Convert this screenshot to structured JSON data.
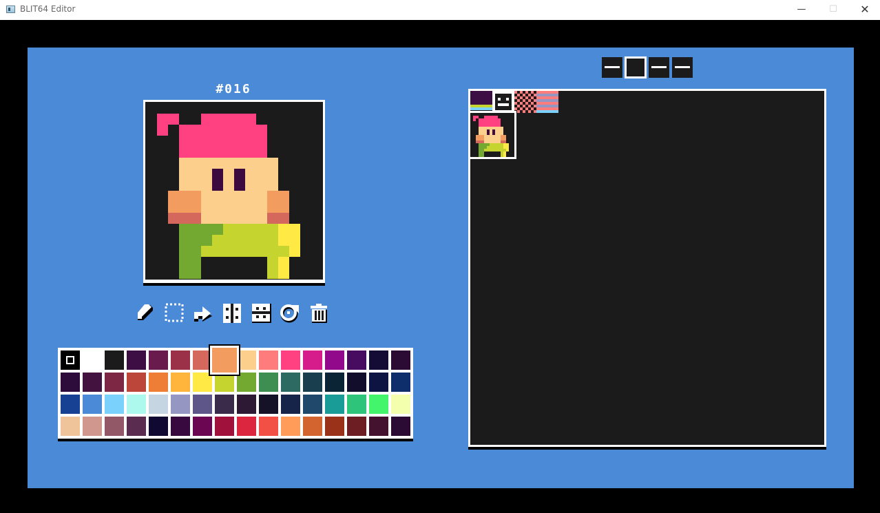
{
  "window": {
    "title": "BLIT64 Editor",
    "min_glyph": "—",
    "max_glyph": "☐",
    "close_glyph": "✕"
  },
  "editor": {
    "sprite_number": "#016"
  },
  "tools": [
    {
      "name": "pencil-tool-icon"
    },
    {
      "name": "select-tool-icon"
    },
    {
      "name": "move-tool-icon"
    },
    {
      "name": "flip-horizontal-tool-icon"
    },
    {
      "name": "flip-vertical-tool-icon"
    },
    {
      "name": "rotate-tool-icon"
    },
    {
      "name": "delete-tool-icon"
    }
  ],
  "palette": {
    "selected_index": 7,
    "marked_index": 0,
    "colors": [
      "#000000",
      "#ffffff",
      "#1b1b1b",
      "#3d0e44",
      "#6a1b4d",
      "#9b3148",
      "#d4685c",
      "#f39c5f",
      "#fccf8d",
      "#fe7c7c",
      "#ff4182",
      "#d61c8a",
      "#920a8b",
      "#470b60",
      "#140c34",
      "#2b0a33",
      "#2d0b3b",
      "#43123e",
      "#7e2744",
      "#bc463a",
      "#ee7e36",
      "#ffb43c",
      "#ffea45",
      "#c6d42f",
      "#74a931",
      "#3e8e51",
      "#2d6b62",
      "#193f4e",
      "#0b2435",
      "#120d2a",
      "#0e1442",
      "#0e2d6b",
      "#174192",
      "#4a8ad6",
      "#7ad1fb",
      "#aef9ee",
      "#c5d5e2",
      "#9696c2",
      "#5e5689",
      "#3a2b4b",
      "#2e1935",
      "#151227",
      "#16244a",
      "#20486b",
      "#199b97",
      "#2ec47a",
      "#43f56a",
      "#f3ffad",
      "#f0c49a",
      "#d0978e",
      "#935867",
      "#5a2d50",
      "#100a32",
      "#37093e",
      "#6b0653",
      "#a0123c",
      "#dc2640",
      "#f24f45",
      "#ff9c5a",
      "#d36430",
      "#993219",
      "#6c1e23",
      "#44112e",
      "#2b0a33"
    ]
  },
  "sheet": {
    "pages": [
      "page-1",
      "page-2",
      "page-3",
      "page-4"
    ],
    "active_page": 1
  },
  "sprite": {
    "colors": {
      "k": "#1b1b1b",
      "p": "#ff4182",
      "s": "#fccf8d",
      "e": "#3d0a3f",
      "o": "#f39c5f",
      "r": "#d4685c",
      "g": "#74a931",
      "l": "#c6d42f",
      "y": "#ffea45"
    },
    "rows": [
      "kkkkkkkkkkkkkkkk",
      "kppkkpppppkkkkkk",
      "kpkppppppppkkkkk",
      "kkkppppppppkkkkk",
      "kkkppppppppkkkkk",
      "kkkssssssssskkkk",
      "kkksssesessskkkk",
      "kkksssesessskkkk",
      "kkooossssssookkk",
      "kkooossssssookkk",
      "kkrrrssssssrrkkk",
      "kkkgggglllllyykk",
      "kkkgggllllllyykk",
      "kkkggllllllllykk",
      "kkkggkkkkkklykkk",
      "kkkggkkkkkklykkk"
    ]
  }
}
